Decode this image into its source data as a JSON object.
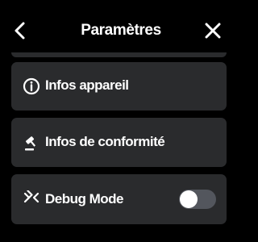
{
  "header": {
    "title": "Paramètres",
    "back_icon": "chevron-left-icon",
    "close_icon": "close-icon"
  },
  "items": [
    {
      "label": "Infos appareil",
      "icon": "info-circle-icon"
    },
    {
      "label": "Infos de conformité",
      "icon": "gavel-icon"
    },
    {
      "label": "Debug Mode",
      "icon": "collapse-arrows-icon",
      "toggle_on": false
    }
  ],
  "colors": {
    "background": "#000000",
    "card": "#2a2b2d",
    "toggle_track_off": "#53565d",
    "toggle_knob": "#ffffff",
    "text": "#ffffff"
  }
}
